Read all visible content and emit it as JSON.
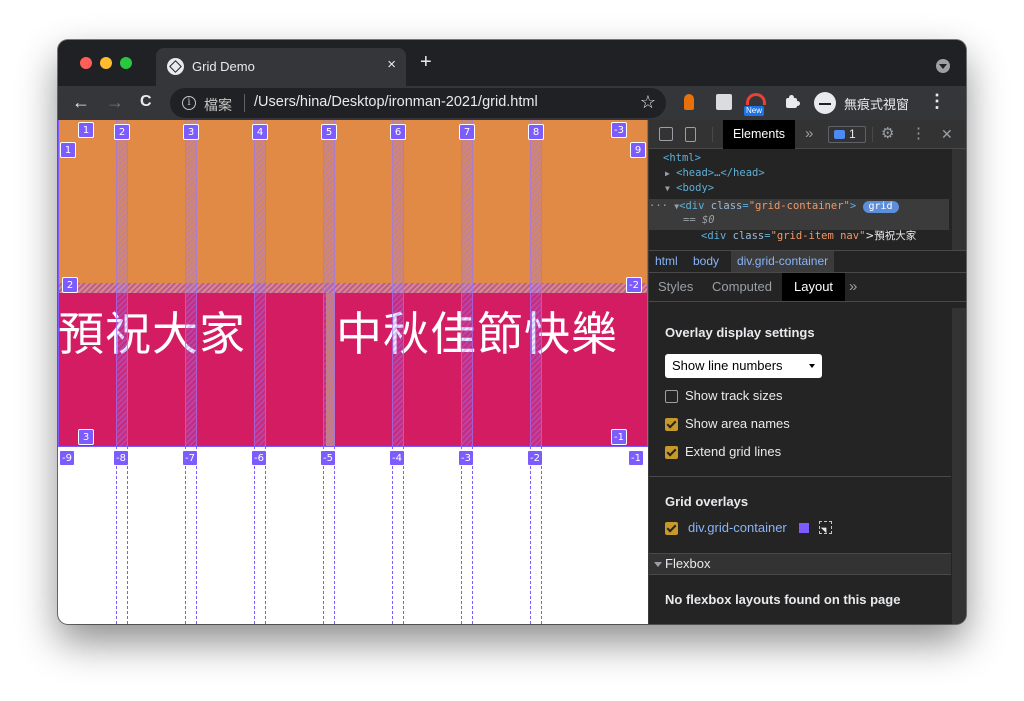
{
  "browser": {
    "tab_title": "Grid Demo",
    "tab_close": "×",
    "new_tab": "+",
    "back": "←",
    "forward": "→",
    "reload": "C",
    "info_icon": "i",
    "scheme_label": "檔案",
    "url": "/Users/hina/Desktop/ironman-2021/grid.html",
    "star": "☆",
    "new_badge": "New",
    "incognito_label": "無痕式視窗",
    "menu": "⋮",
    "colors": {
      "accent": "#7c5cff",
      "tab_bg": "#35363a",
      "frame_bg": "#202124"
    }
  },
  "page": {
    "text_left": "預祝大家",
    "text_right": "中秋佳節快樂",
    "row1_color": "#e08a45",
    "row2_color": "#d41c62",
    "column_line_numbers": [
      "1",
      "2",
      "3",
      "4",
      "5",
      "6",
      "7",
      "8",
      "-3"
    ],
    "negative_column_numbers": [
      "-9",
      "-8",
      "-7",
      "-6",
      "-5",
      "-4",
      "-3",
      "-2",
      "-1"
    ],
    "row_line_numbers": [
      "1",
      "2",
      "3"
    ],
    "negative_row_numbers": [
      "9",
      "-2",
      "-1"
    ]
  },
  "devtools": {
    "tabs": {
      "elements": "Elements",
      "more": "»",
      "issues_count": "1",
      "settings": "⚙",
      "menu": "⋮",
      "close": "✕"
    },
    "dom": {
      "html": "<html>",
      "head_toggle": "▶",
      "head": "<head>…</head>",
      "body_toggle": "▼",
      "body": "<body>",
      "ellipsis": "···",
      "div_toggle": "▼",
      "div_open": "<div",
      "div_attr": "class",
      "div_val": "\"grid-container\"",
      "div_close": ">",
      "grid_pill": "grid",
      "dollar": "== $0",
      "child_open": "<div",
      "child_attr": "class",
      "child_val": "\"grid-item nav\"",
      "child_text": ">預祝大家"
    },
    "breadcrumb": [
      "html",
      "body",
      "div.grid-container"
    ],
    "subtabs": {
      "styles": "Styles",
      "computed": "Computed",
      "layout": "Layout",
      "more": "»"
    },
    "layout": {
      "overlay_title": "Overlay display settings",
      "select_value": "Show line numbers",
      "show_track_sizes": "Show track sizes",
      "show_area_names": "Show area names",
      "extend_grid_lines": "Extend grid lines",
      "grid_overlays_title": "Grid overlays",
      "grid_overlay_item": "div.grid-container",
      "flexbox_title": "Flexbox",
      "no_flexbox": "No flexbox layouts found on this page"
    }
  }
}
